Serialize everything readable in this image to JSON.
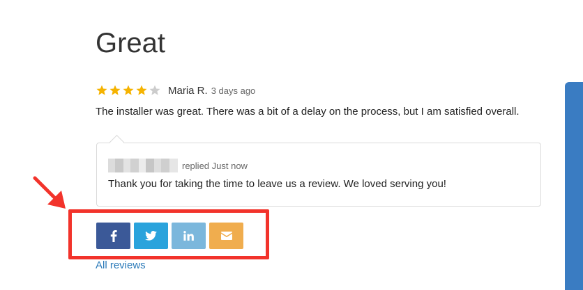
{
  "review": {
    "title": "Great",
    "rating": 4,
    "rating_max": 5,
    "author": "Maria R.",
    "time": "3 days ago",
    "text": "The installer was great. There was a bit of a delay on the process, but I am satisfied overall."
  },
  "reply": {
    "meta": "replied Just now",
    "text": "Thank you for taking the time to leave us a review. We loved serving you!"
  },
  "share": {
    "buttons": [
      {
        "icon": "facebook-icon",
        "color": "#3b5998"
      },
      {
        "icon": "twitter-icon",
        "color": "#2aa3dc"
      },
      {
        "icon": "linkedin-icon",
        "color": "#7bb7dc"
      },
      {
        "icon": "email-icon",
        "color": "#f0ad4e"
      }
    ]
  },
  "links": {
    "all_reviews": "All reviews"
  },
  "colors": {
    "star_filled": "#f5b301",
    "star_empty": "#cccccc",
    "highlight": "#f2332b",
    "link": "#2b7ab9",
    "side_panel": "#3a7cc2"
  }
}
